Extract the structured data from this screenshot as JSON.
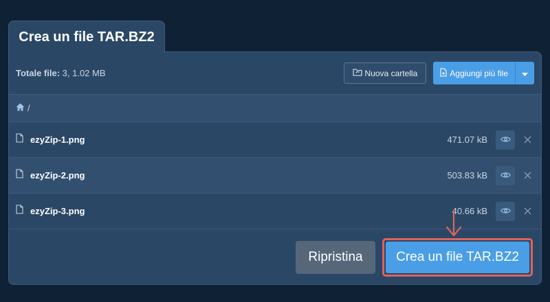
{
  "tab": {
    "title": "Crea un file TAR.BZ2"
  },
  "toolbar": {
    "total_label": "Totale file:",
    "total_value": " 3, 1.02 MB",
    "new_folder_label": "Nuova cartella",
    "add_files_label": "Aggiungi più file"
  },
  "breadcrumb": {
    "path": "/"
  },
  "files": [
    {
      "name": "ezyZip-1.png",
      "size": "471.07 kB"
    },
    {
      "name": "ezyZip-2.png",
      "size": "503.83 kB"
    },
    {
      "name": "ezyZip-3.png",
      "size": "40.66 kB"
    }
  ],
  "actions": {
    "reset_label": "Ripristina",
    "create_label": "Crea un file TAR.BZ2"
  },
  "colors": {
    "background": "#0f2235",
    "panel": "#2b4766",
    "primary": "#4a9ee6",
    "secondary": "#56677a",
    "highlight": "#e0645b"
  },
  "icons": {
    "new_folder": "folder-sync-icon",
    "add_files": "file-plus-icon",
    "caret": "caret-down-icon",
    "home": "home-icon",
    "file": "file-icon",
    "preview": "eye-icon",
    "remove": "close-icon",
    "annotation": "arrow-down-icon"
  }
}
